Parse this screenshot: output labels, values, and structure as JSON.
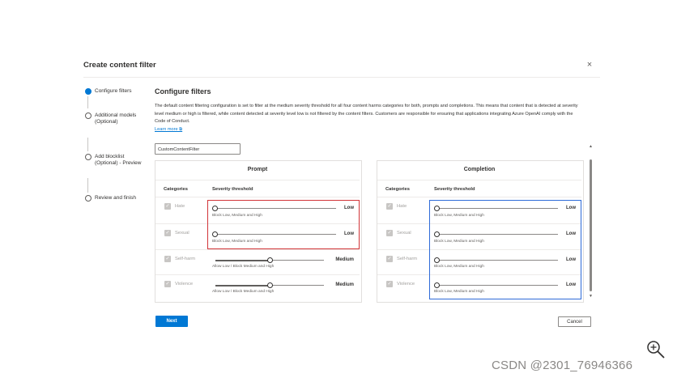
{
  "dialog": {
    "title": "Create content filter",
    "close_glyph": "×"
  },
  "steps": [
    {
      "label": "Configure filters",
      "active": true
    },
    {
      "label": "Additional models (Optional)",
      "active": false
    },
    {
      "label": "Add blocklist (Optional) - Preview",
      "active": false
    },
    {
      "label": "Review and finish",
      "active": false
    }
  ],
  "main": {
    "heading": "Configure filters",
    "description": "The default content filtering configuration is set to filter at the medium severity threshold for all four content harms categories for both, prompts and completions. This means that content that is detected at severity level medium or high is filtered, while content detected at severity level low is not filtered by the content filters. Customers are responsible for ensuring that applications integrating Azure OpenAI comply with the Code of Conduct.",
    "learn_more": "Learn more ⧉",
    "filter_name": "CustomContentFilter"
  },
  "prompt": {
    "title": "Prompt",
    "col_categories": "Categories",
    "col_severity": "Severity threshold",
    "rows": [
      {
        "category": "Hate",
        "level": "Low",
        "hint": "Block Low, Medium and High",
        "value": 0
      },
      {
        "category": "Sexual",
        "level": "Low",
        "hint": "Block Low, Medium and High",
        "value": 0
      },
      {
        "category": "Self-harm",
        "level": "Medium",
        "hint": "Allow Low / Block Medium and High",
        "value": 0.5
      },
      {
        "category": "Violence",
        "level": "Medium",
        "hint": "Allow Low / Block Medium and High",
        "value": 0.5
      }
    ]
  },
  "completion": {
    "title": "Completion",
    "col_categories": "Categories",
    "col_severity": "Severity threshold",
    "rows": [
      {
        "category": "Hate",
        "level": "Low",
        "hint": "Block Low, Medium and High",
        "value": 0
      },
      {
        "category": "Sexual",
        "level": "Low",
        "hint": "Block Low, Medium and High",
        "value": 0
      },
      {
        "category": "Self-harm",
        "level": "Low",
        "hint": "Block Low, Medium and High",
        "value": 0
      },
      {
        "category": "Violence",
        "level": "Low",
        "hint": "Block Low, Medium and High",
        "value": 0
      }
    ]
  },
  "footer": {
    "next_label": "Next",
    "cancel_label": "Cancel"
  },
  "watermark": "CSDN @2301_76946366",
  "colors": {
    "accent": "#0078d4",
    "highlight_red": "#d13438",
    "highlight_blue": "#2e6bd8"
  }
}
